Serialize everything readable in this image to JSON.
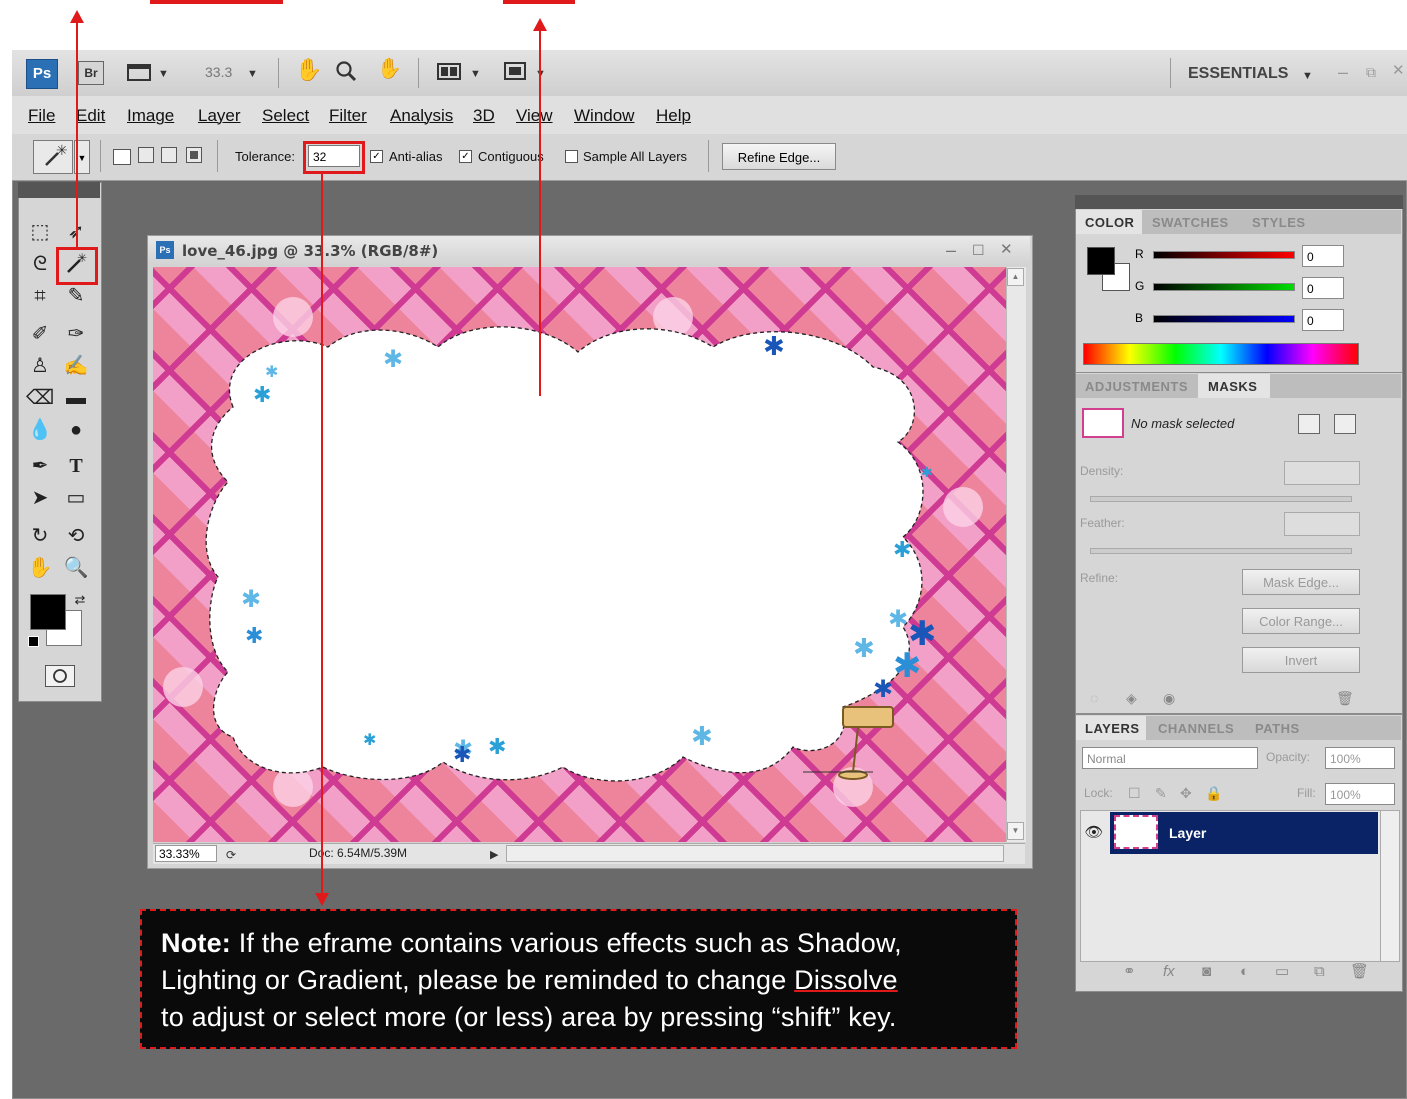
{
  "app": {
    "logo": "Ps",
    "bridge": "Br",
    "zoom_value": "33.3",
    "workspace": "ESSENTIALS"
  },
  "menu": [
    "File",
    "Edit",
    "Image",
    "Layer",
    "Select",
    "Filter",
    "Analysis",
    "3D",
    "View",
    "Window",
    "Help"
  ],
  "options": {
    "tolerance_label": "Tolerance:",
    "tolerance_value": "32",
    "antialias_label": "Anti-alias",
    "contiguous_label": "Contiguous",
    "sample_all_label": "Sample All Layers",
    "refine_edge_label": "Refine Edge..."
  },
  "document": {
    "title": "love_46.jpg @ 33.3% (RGB/8#)",
    "zoom_status": "33.33%",
    "doc_size": "Doc: 6.54M/5.39M"
  },
  "color_panel": {
    "tabs": [
      "COLOR",
      "SWATCHES",
      "STYLES"
    ],
    "r_label": "R",
    "r_value": "0",
    "g_label": "G",
    "g_value": "0",
    "b_label": "B",
    "b_value": "0"
  },
  "masks_panel": {
    "tabs": [
      "ADJUSTMENTS",
      "MASKS"
    ],
    "no_mask": "No mask selected",
    "density_label": "Density:",
    "feather_label": "Feather:",
    "refine_label": "Refine:",
    "mask_edge": "Mask Edge...",
    "color_range": "Color Range...",
    "invert": "Invert"
  },
  "layers_panel": {
    "tabs": [
      "LAYERS",
      "CHANNELS",
      "PATHS"
    ],
    "blend_mode": "Normal",
    "opacity_label": "Opacity:",
    "opacity_value": "100%",
    "lock_label": "Lock:",
    "fill_label": "Fill:",
    "fill_value": "100%",
    "layer_name": "Layer"
  },
  "note": {
    "bold": "Note:",
    "line1": " If the eframe contains various effects such as Shadow,",
    "line2a": "Lighting or Gradient, please be reminded to change ",
    "line2b": "Dissolve",
    "line3": "to adjust or select more (or less) area by pressing “shift” key."
  },
  "colors": {
    "annotation_red": "#e01a1a",
    "canvas_pink": "#f2a0c8",
    "layer_selected": "#0a2266"
  }
}
